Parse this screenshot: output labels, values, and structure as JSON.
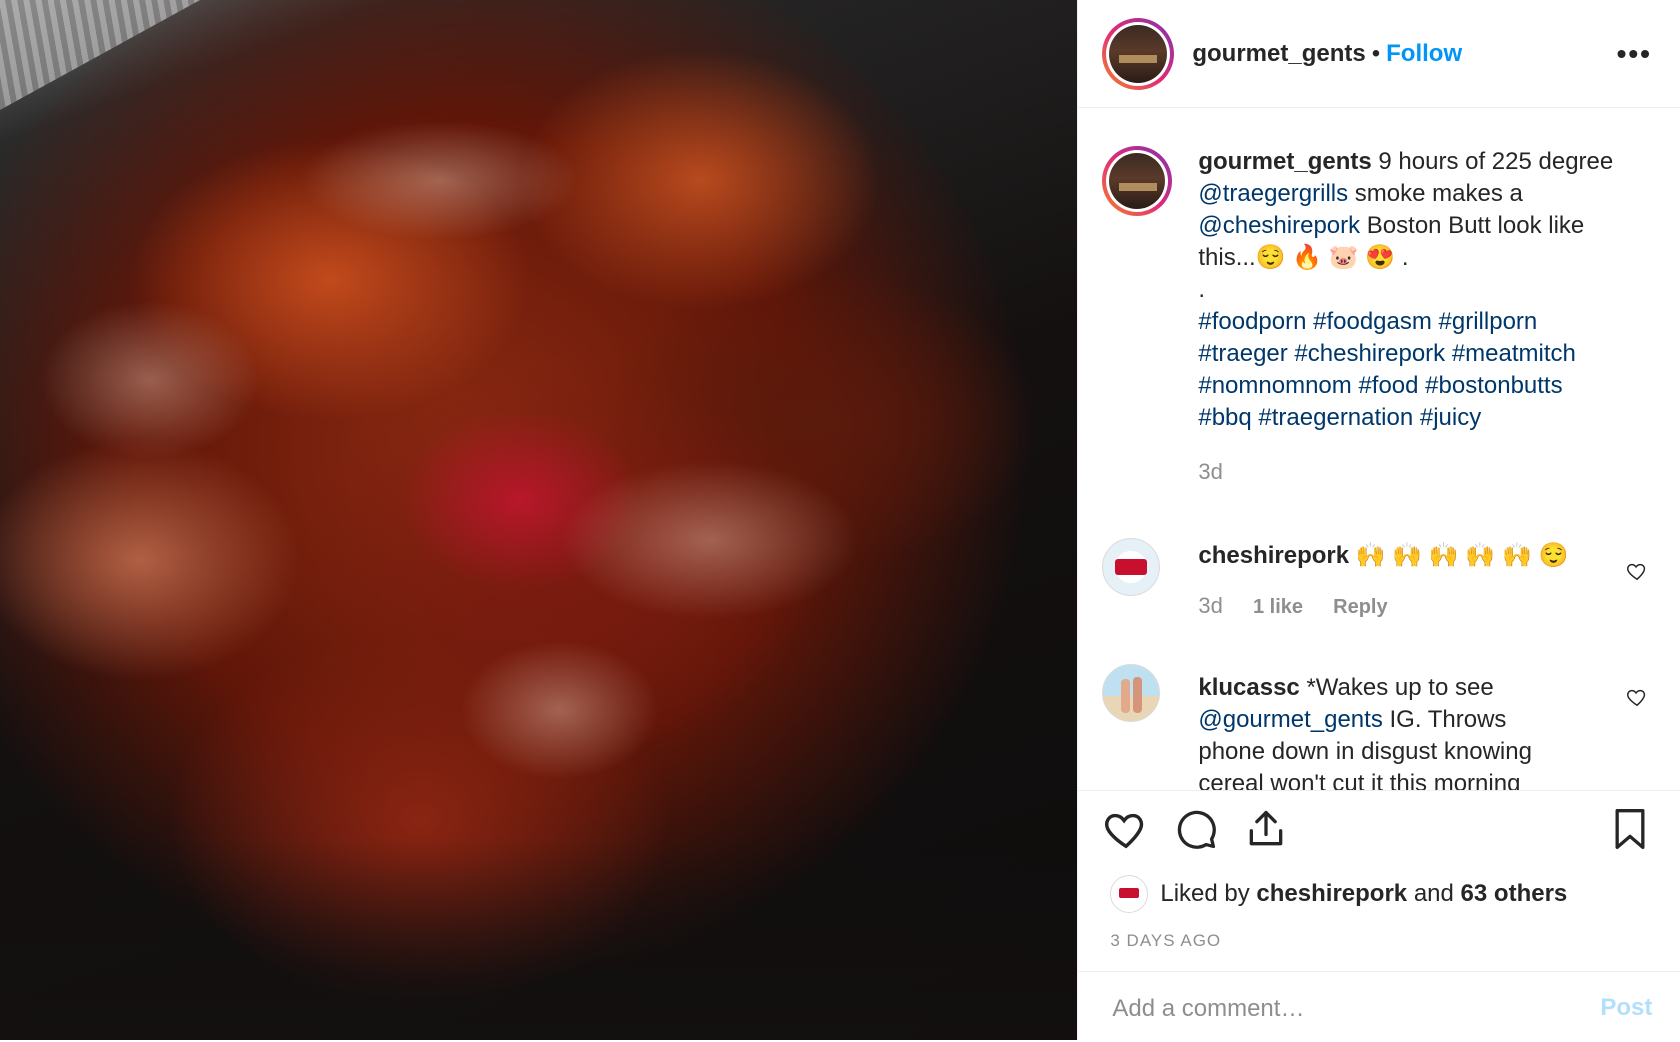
{
  "header": {
    "username": "gourmet_gents",
    "separator": "•",
    "follow_label": "Follow",
    "more_label": "•••"
  },
  "caption": {
    "username": "gourmet_gents",
    "text_1": "9 hours of 225 degree",
    "mention_1": "@traegergrills",
    "text_2": "smoke makes a",
    "mention_2": "@cheshirepork",
    "text_3": "Boston Butt look like",
    "text_4": "this...😌 🔥 🐷 😍 .",
    "text_5": ".",
    "hashtags_line1": "#foodporn #foodgasm #grillporn",
    "hashtags_line2": "#traeger #cheshirepork #meatmitch",
    "hashtags_line3": "#nomnomnom #food #bostonbutts",
    "hashtags_line4": "#bbq #traegernation #juicy",
    "time": "3d"
  },
  "comments": [
    {
      "username": "cheshirepork",
      "text": "🙌 🙌 🙌 🙌 🙌 😌",
      "time": "3d",
      "likes": "1 like",
      "reply": "Reply"
    },
    {
      "username": "klucassc",
      "text_1": "*Wakes up to see",
      "mention": "@gourmet_gents",
      "text_2": "IG. Throws",
      "text_3": "phone down in disgust knowing",
      "text_4": "cereal won't cut it this morning"
    }
  ],
  "likes": {
    "prefix": "Liked by",
    "user": "cheshirepork",
    "middle": "and",
    "others": "63 others"
  },
  "date": "3 DAYS AGO",
  "add_comment": {
    "placeholder": "Add a comment…",
    "post_label": "Post"
  },
  "colors": {
    "accent": "#0095f6",
    "link": "#00376b",
    "muted": "#8e8e8e",
    "post_disabled": "#b2dffc"
  }
}
